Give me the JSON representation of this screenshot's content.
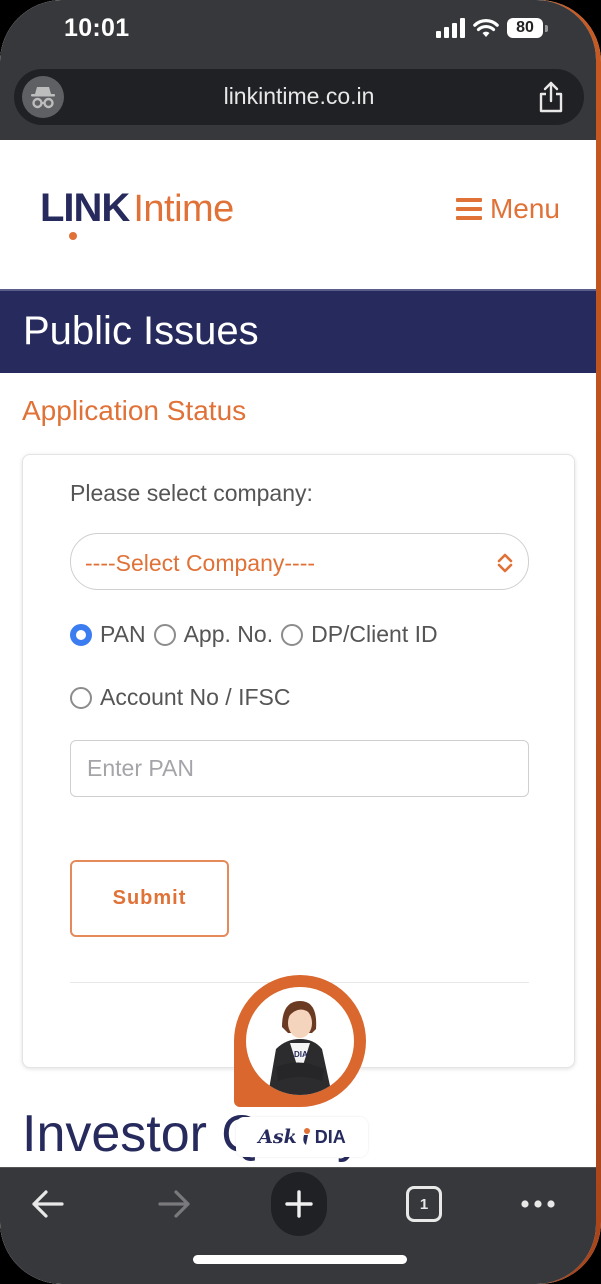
{
  "status_bar": {
    "time": "10:01",
    "battery": "80",
    "icons": [
      "signal-icon",
      "wifi-icon",
      "battery-icon"
    ]
  },
  "browser": {
    "url": "linkintime.co.in",
    "left_icon": "incognito-icon",
    "right_icon": "share-icon",
    "tab_count": "1",
    "bottom_icons": [
      "back-arrow-icon",
      "forward-arrow-icon",
      "new-tab-plus-icon",
      "tabs-icon",
      "more-icon"
    ]
  },
  "header": {
    "logo_bold": "LINK",
    "logo_light": "Intime",
    "menu_label": "Menu"
  },
  "banner": {
    "title": "Public Issues"
  },
  "section": {
    "title": "Application Status"
  },
  "form": {
    "select_label": "Please select company:",
    "select_value": "----Select Company----",
    "radios": [
      {
        "label": "PAN",
        "checked": true
      },
      {
        "label": "App. No.",
        "checked": false
      },
      {
        "label": "DP/Client ID",
        "checked": false
      },
      {
        "label": "Account No / IFSC",
        "checked": false
      }
    ],
    "pan_placeholder": "Enter PAN",
    "pan_value": "",
    "submit_label": "Submit"
  },
  "next_section": {
    "title": "Investor Query"
  },
  "chat_widget": {
    "ask": "Ask",
    "name": "DIA"
  },
  "colors": {
    "brand_navy": "#262a5c",
    "brand_orange": "#e07238",
    "radio_selected": "#3b7cf0",
    "chrome_dark": "#37383b"
  }
}
